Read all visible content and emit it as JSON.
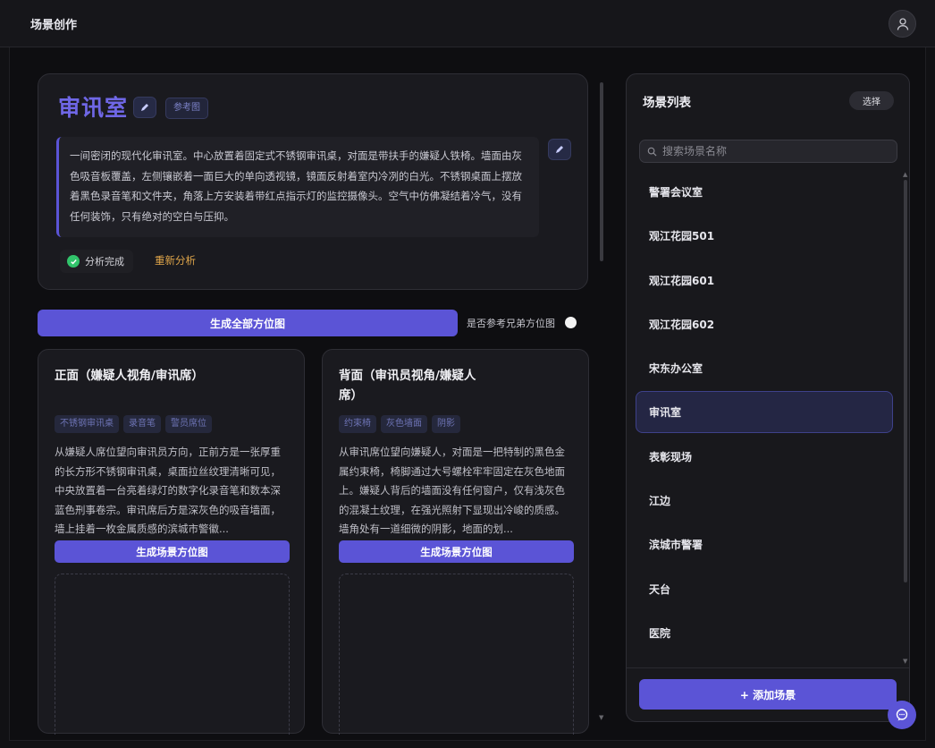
{
  "header": {
    "app_title": "场景创作",
    "avatar_icon": "user-icon"
  },
  "scene": {
    "title": "审讯室",
    "ref_tag": "参考图",
    "description": "一间密闭的现代化审讯室。中心放置着固定式不锈钢审讯桌，对面是带扶手的嫌疑人铁椅。墙面由灰色吸音板覆盖，左侧镶嵌着一面巨大的单向透视镜，镜面反射着室内冷冽的白光。不锈钢桌面上摆放着黑色录音笔和文件夹，角落上方安装着带红点指示灯的监控摄像头。空气中仿佛凝结着冷气，没有任何装饰，只有绝对的空白与压抑。",
    "status": "分析完成",
    "reanalyze_label": "重新分析"
  },
  "toolbar": {
    "generate_all_label": "生成全部方位图",
    "ref_sibling_label": "是否参考兄弟方位图"
  },
  "views": [
    {
      "title": "正面（嫌疑人视角/审讯席）",
      "tags": [
        "不锈钢审讯桌",
        "录音笔",
        "警员席位"
      ],
      "description": "从嫌疑人席位望向审讯员方向，正前方是一张厚重的长方形不锈钢审讯桌，桌面拉丝纹理清晰可见，中央放置着一台亮着绿灯的数字化录音笔和数本深蓝色刑事卷宗。审讯席后方是深灰色的吸音墙面，墙上挂着一枚金属质感的滨城市警徽...",
      "generate_label": "生成场景方位图"
    },
    {
      "title": "背面（审讯员视角/嫌疑人席）",
      "tags": [
        "约束椅",
        "灰色墙面",
        "阴影"
      ],
      "description": "从审讯席位望向嫌疑人，对面是一把特制的黑色金属约束椅，椅脚通过大号螺栓牢牢固定在灰色地面上。嫌疑人背后的墙面没有任何窗户，仅有浅灰色的混凝土纹理，在强光照射下显现出冷峻的质感。墙角处有一道细微的阴影，地面的划...",
      "generate_label": "生成场景方位图"
    }
  ],
  "scene_panel": {
    "title": "场景列表",
    "select_label": "选择",
    "search_placeholder": "搜索场景名称",
    "items": [
      "警署会议室",
      "观江花园501",
      "观江花园601",
      "观江花园602",
      "宋东办公室",
      "审讯室",
      "表彰现场",
      "江边",
      "滨城市警署",
      "天台",
      "医院"
    ],
    "active_item": "审讯室",
    "add_label": "+ 添加场景"
  },
  "chat_icon": "chat-bubble-icon"
}
